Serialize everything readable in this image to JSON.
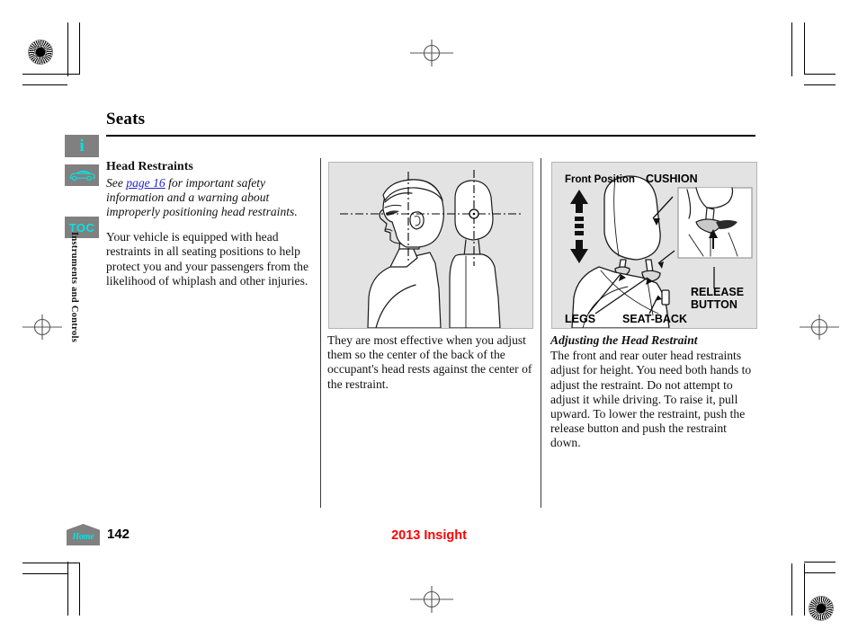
{
  "document": {
    "title": "2013 Insight",
    "page_number": "142",
    "section_title": "Seats",
    "side_tab_label": "Instruments and Controls"
  },
  "sidebar": {
    "items": [
      {
        "name": "info",
        "icon": "info-icon",
        "label": "i"
      },
      {
        "name": "vehicle",
        "icon": "car-icon",
        "label": ""
      },
      {
        "name": "toc",
        "icon": "toc-icon",
        "label": "TOC"
      }
    ]
  },
  "footer": {
    "home_label": "Home",
    "page_number": "142",
    "doc_title": "2013 Insight"
  },
  "content": {
    "column_1": {
      "heading": "Head Restraints",
      "reference_prefix": "See ",
      "reference_link": "page 16",
      "reference_suffix": " for important safety information and a warning about improperly positioning head restraints.",
      "paragraph": "Your vehicle is equipped with head restraints in all seating positions to help protect you and your passengers from the likelihood of whiplash and other injuries."
    },
    "column_2": {
      "caption": "They are most effective when you adjust them so the center of the back of the occupant's head rests against the center of the restraint."
    },
    "column_3": {
      "heading": "Adjusting the Head Restraint",
      "paragraph": "The front and rear outer head restraints adjust for height. You need both hands to adjust the restraint. Do not attempt to adjust it while driving. To raise it, pull upward. To lower the restraint, push the release button and push the restraint down."
    }
  },
  "figures": {
    "center": {
      "name": "head-restraint-position-illustration",
      "description": "Side profile of seated occupant with head restraint alignment crosshairs"
    },
    "right": {
      "name": "head-restraint-parts-illustration",
      "labels": {
        "front_position": "Front Position",
        "cushion": "CUSHION",
        "release_button_line1": "RELEASE",
        "release_button_line2": "BUTTON",
        "legs": "LEGS",
        "seat_back": "SEAT-BACK"
      }
    }
  },
  "colors": {
    "accent_cyan": "#00e5e5",
    "icon_gray": "#808080",
    "link_blue": "#2222cc",
    "doc_title_red": "#ff0000",
    "figure_bg": "#e3e3e3"
  }
}
